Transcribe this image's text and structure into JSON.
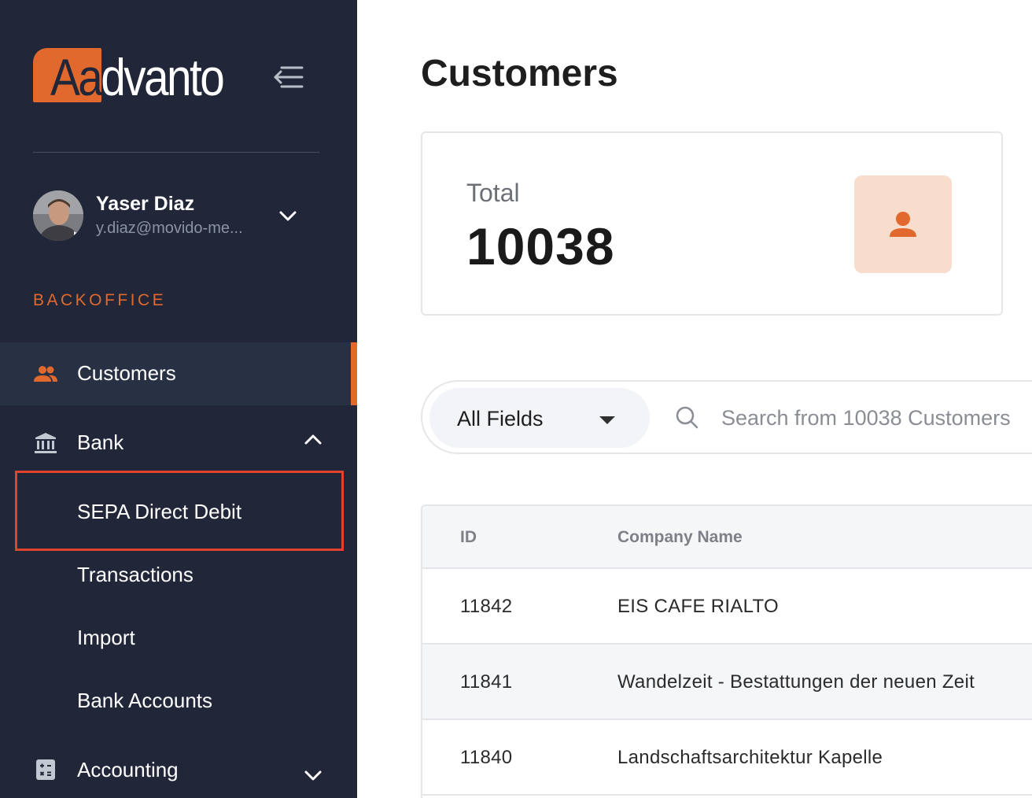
{
  "brand": {
    "logo_first": "Aa",
    "logo_rest": "dvanto",
    "accent": "#e2692d",
    "sidebar_bg": "#212739"
  },
  "user": {
    "name": "Yaser Diaz",
    "email": "y.diaz@movido-me..."
  },
  "sidebar": {
    "section": "BACKOFFICE",
    "customers": "Customers",
    "bank": "Bank",
    "bank_items": [
      "SEPA Direct Debit",
      "Transactions",
      "Import",
      "Bank Accounts"
    ],
    "accounting": "Accounting"
  },
  "main": {
    "title": "Customers",
    "total_label": "Total",
    "total_value": "10038",
    "field_select": "All Fields",
    "search_placeholder": "Search from 10038 Customers"
  },
  "table": {
    "headers": [
      "ID",
      "Company Name"
    ],
    "rows": [
      {
        "id": "11842",
        "company": "EIS CAFE RIALTO"
      },
      {
        "id": "11841",
        "company": "Wandelzeit - Bestattungen der neuen Zeit"
      },
      {
        "id": "11840",
        "company": "Landschaftsarchitektur Kapelle"
      }
    ]
  }
}
